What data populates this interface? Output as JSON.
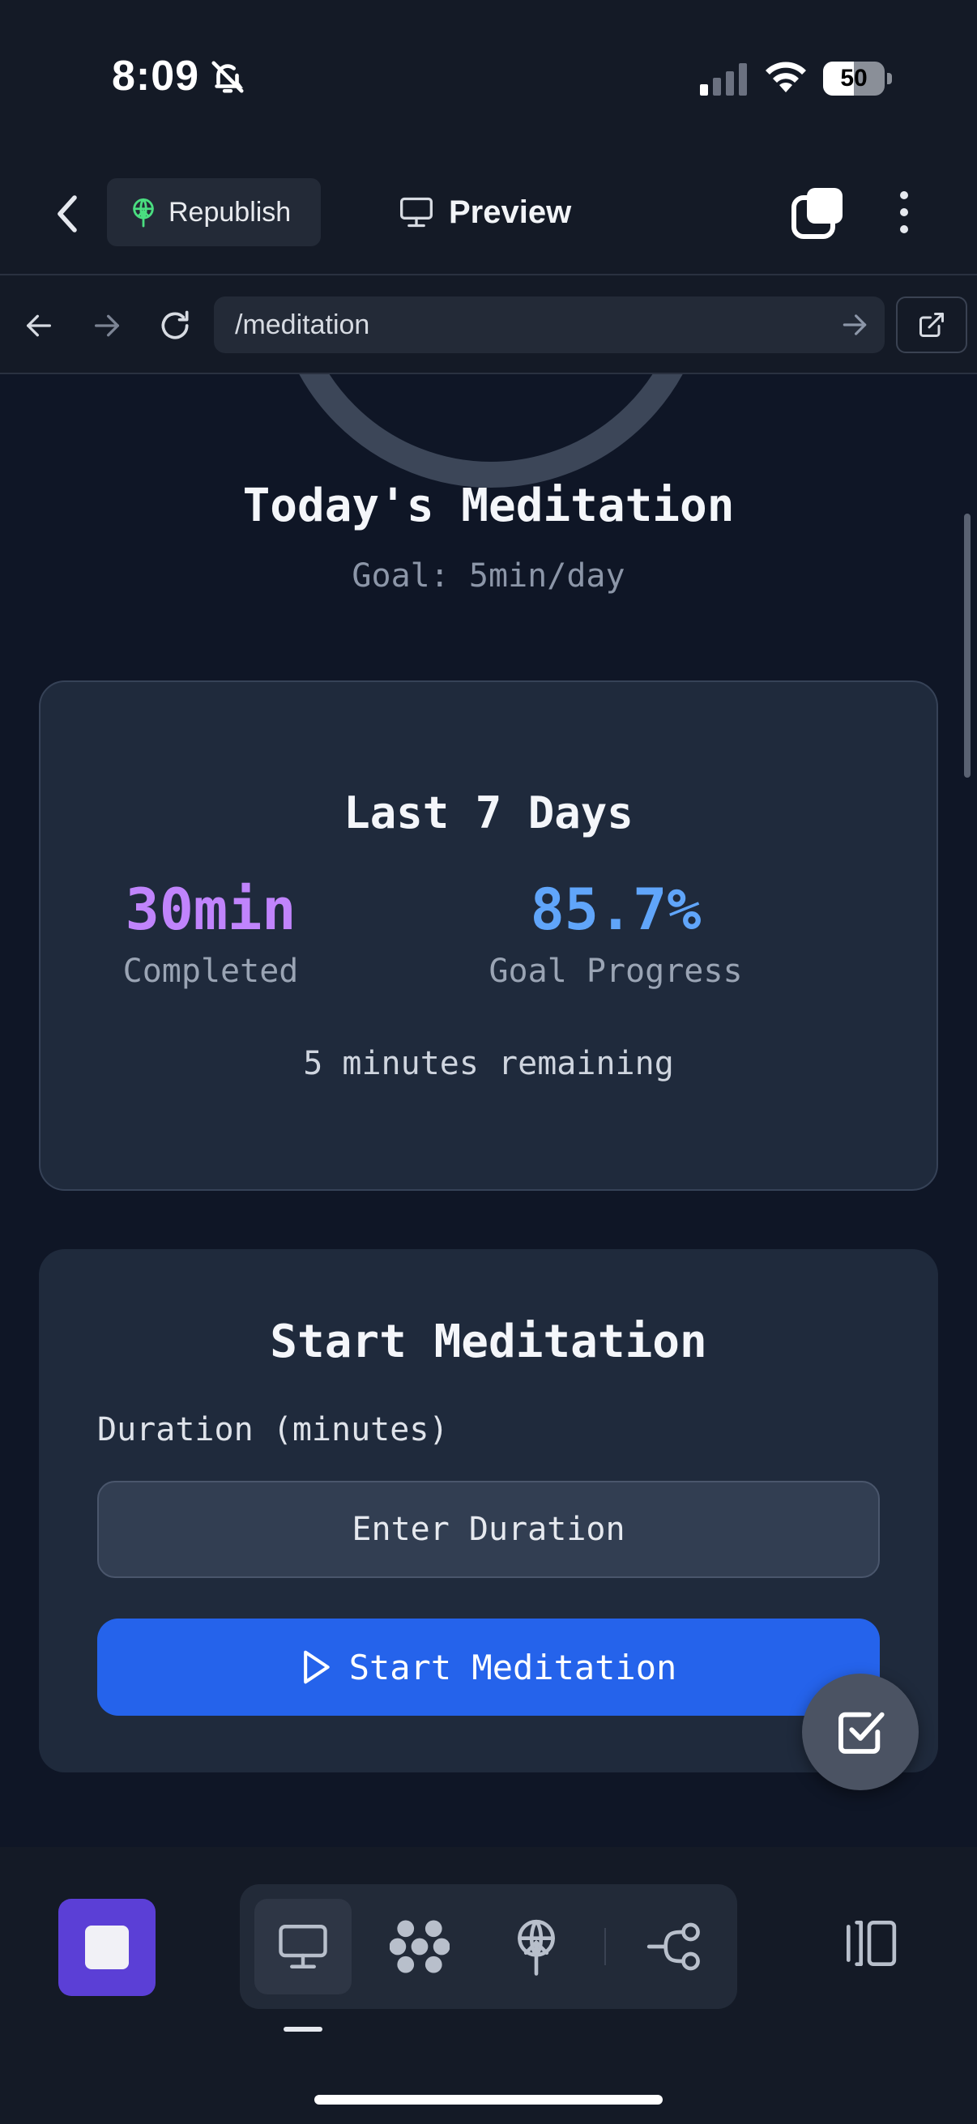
{
  "status_bar": {
    "time": "8:09",
    "battery": "50",
    "battery_level": 0.5
  },
  "header": {
    "republish_label": "Republish",
    "preview_label": "Preview"
  },
  "url_bar": {
    "path": "/meditation"
  },
  "page": {
    "title": "Today's Meditation",
    "goal": "Goal: 5min/day"
  },
  "stats": {
    "title": "Last 7 Days",
    "completed_value": "30min",
    "completed_label": "Completed",
    "progress_value": "85.7%",
    "progress_label": "Goal Progress",
    "remaining": "5 minutes remaining"
  },
  "start": {
    "title": "Start Meditation",
    "duration_label": "Duration (minutes)",
    "duration_placeholder": "Enter Duration",
    "button_label": "Start Meditation"
  },
  "colors": {
    "completed": "#c084fc",
    "progress": "#60a5fa",
    "primary": "#2563eb",
    "app_square": "#5b3fd6"
  },
  "icons": {
    "toolbar": [
      "desktop-icon",
      "components-icon",
      "publish-icon",
      "workflow-icon",
      "panel-toggle-icon"
    ]
  }
}
